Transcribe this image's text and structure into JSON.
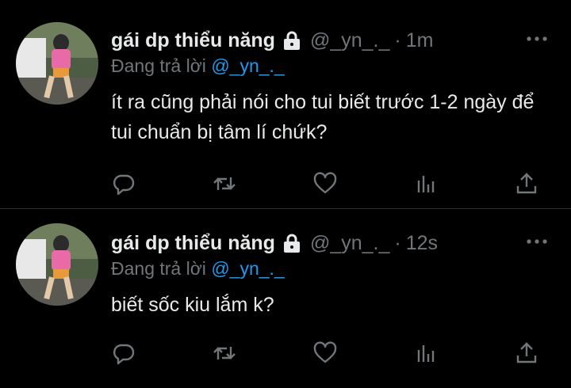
{
  "tweets": [
    {
      "display_name": "gái dp thiểu năng",
      "handle": "@_yn_._",
      "separator": "·",
      "time": "1m",
      "replying_prefix": "Đang trả lời",
      "replying_to": "@_yn_._",
      "text": "ít ra cũng phải nói cho tui biết trước 1-2 ngày để tui chuẩn bị tâm lí chứk?",
      "icons": {
        "lock": "lock-icon",
        "more": "more-icon",
        "reply": "reply-icon",
        "retweet": "retweet-icon",
        "like": "heart-icon",
        "views": "views-icon",
        "share": "share-icon"
      }
    },
    {
      "display_name": "gái dp thiểu năng",
      "handle": "@_yn_._",
      "separator": "·",
      "time": "12s",
      "replying_prefix": "Đang trả lời",
      "replying_to": "@_yn_._",
      "text": "biết sốc kiu lắm k?",
      "icons": {
        "lock": "lock-icon",
        "more": "more-icon",
        "reply": "reply-icon",
        "retweet": "retweet-icon",
        "like": "heart-icon",
        "views": "views-icon",
        "share": "share-icon"
      }
    }
  ],
  "colors": {
    "background": "#000000",
    "primary_text": "#e7e9ea",
    "secondary_text": "#71767b",
    "accent": "#1d9bf0",
    "divider": "#2f3336"
  }
}
